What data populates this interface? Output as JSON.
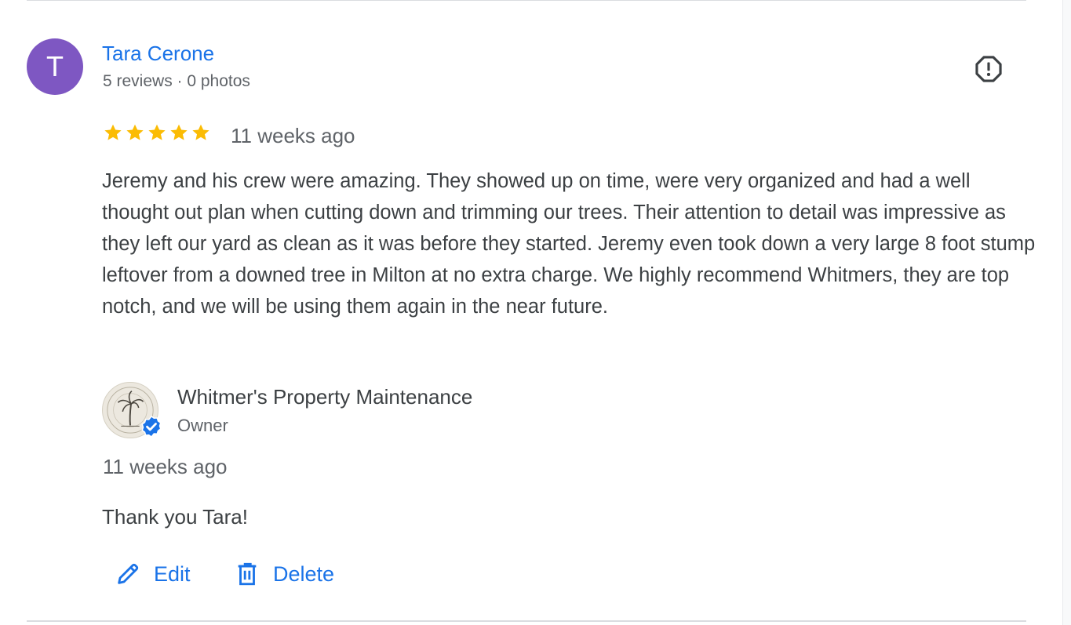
{
  "review": {
    "avatar_letter": "T",
    "avatar_color": "#7e57c2",
    "reviewer_name": "Tara Cerone",
    "reviewer_meta": "5 reviews · 0 photos",
    "rating": 5,
    "rating_max": 5,
    "date": "11 weeks ago",
    "text": "Jeremy and his crew were amazing. They showed up on time, were very organized and had a well thought out plan when cutting down and trimming our trees. Their attention to detail was impressive as they left our yard as clean as it was before they started. Jeremy even took down a very large 8 foot stump leftover from a downed tree in Milton at no extra charge. We highly recommend Whitmers, they are top notch, and we will be using them again in the near future.",
    "flag_icon": "report-icon"
  },
  "owner_reply": {
    "owner_name": "Whitmer's Property Maintenance",
    "owner_role": "Owner",
    "logo_icon": "palm-tree-logo",
    "badge_icon": "verified-badge-icon",
    "date": "11 weeks ago",
    "text": "Thank you Tara!"
  },
  "actions": {
    "edit_label": "Edit",
    "edit_icon": "pencil-icon",
    "delete_label": "Delete",
    "delete_icon": "trash-icon"
  },
  "colors": {
    "link": "#1a73e8",
    "star": "#fbbc04",
    "text": "#3c4043",
    "muted": "#5f6368",
    "divider": "#dadce0"
  }
}
